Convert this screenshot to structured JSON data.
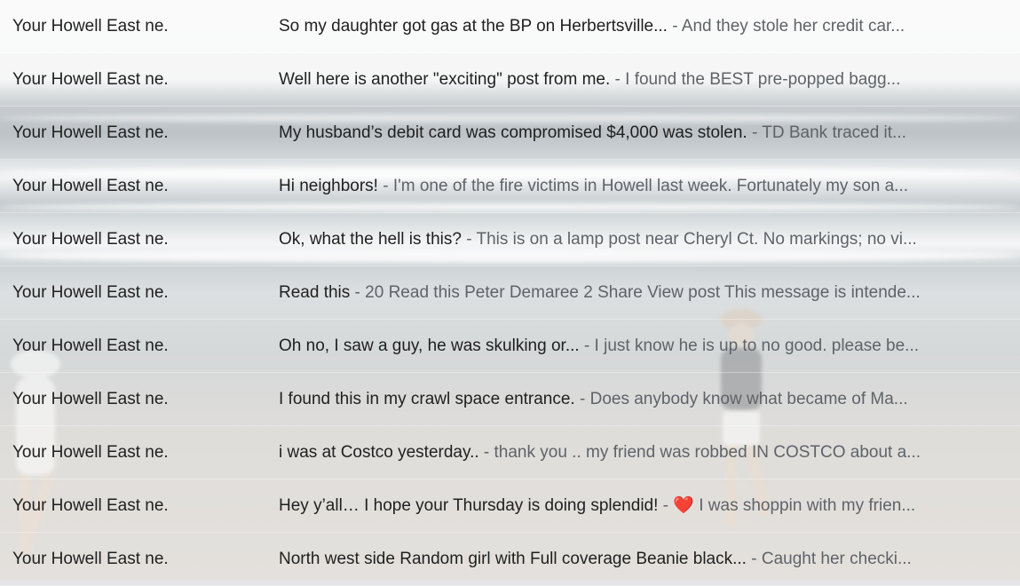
{
  "rows": [
    {
      "sender": "Your Howell East ne.",
      "subject": "So my daughter got gas at the BP on Herbertsville...",
      "sep": " - ",
      "snippet": "And they stole her credit car..."
    },
    {
      "sender": "Your Howell East ne.",
      "subject": "Well here is another \"exciting\" post from me.",
      "sep": " - ",
      "snippet": "I found the BEST pre-popped bagg..."
    },
    {
      "sender": "Your Howell East ne.",
      "subject": "My husband’s debit card was compromised $4,000 was stolen.",
      "sep": " - ",
      "snippet": "TD Bank traced it..."
    },
    {
      "sender": "Your Howell East ne.",
      "subject": "Hi neighbors!",
      "sep": " - ",
      "snippet": "I'm one of the fire victims in Howell last week. Fortunately my son a..."
    },
    {
      "sender": "Your Howell East ne.",
      "subject": "Ok, what the hell is this?",
      "sep": " - ",
      "snippet": "This is on a lamp post near Cheryl Ct. No markings; no vi..."
    },
    {
      "sender": "Your Howell East ne.",
      "subject": "Read this",
      "sep": " - ",
      "snippet": "20 Read this Peter Demaree 2 Share View post This message is intende..."
    },
    {
      "sender": "Your Howell East ne.",
      "subject": "Oh no, I saw a guy, he was skulking or...",
      "sep": " - ",
      "snippet": "I just know he is up to no good. please be..."
    },
    {
      "sender": "Your Howell East ne.",
      "subject": "I found this in my crawl space entrance.",
      "sep": " - ",
      "snippet": "Does anybody know what became of Ma..."
    },
    {
      "sender": "Your Howell East ne.",
      "subject": "i was at Costco yesterday..",
      "sep": " - ",
      "snippet": "thank you .. my friend was robbed IN COSTCO about a..."
    },
    {
      "sender": "Your Howell East ne.",
      "subject": "Hey y’all… I hope your Thursday is doing splendid!",
      "sep": " - ",
      "emoji": "❤️",
      "snippet": " I was shoppin with my frien..."
    },
    {
      "sender": "Your Howell East ne.",
      "subject": "North west side Random girl with Full coverage Beanie black...",
      "sep": " - ",
      "snippet": "Caught her checki..."
    }
  ],
  "colors": {
    "subject": "#1f1f1f",
    "snippet": "#5f6368",
    "heart": "#e0182d"
  }
}
